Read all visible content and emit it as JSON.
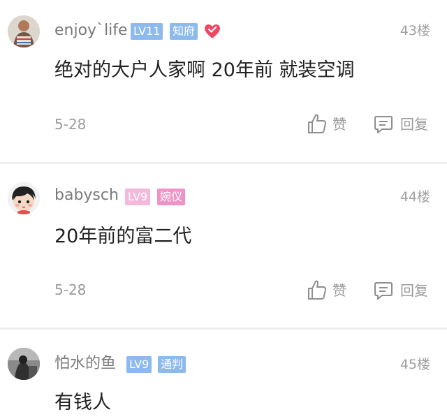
{
  "accent": "#8cb9ee",
  "posts": [
    {
      "username": "enjoy`life",
      "level": "LV11",
      "title": "知府",
      "floor": "43楼",
      "text": "绝对的大户人家啊 20年前 就装空调",
      "date": "5-28",
      "like_label": "赞",
      "reply_label": "回复",
      "level_color": "#8cb9ee",
      "title_color": "#8cb9ee",
      "has_heart": true
    },
    {
      "username": "babysch",
      "level": "LV9",
      "title": "婉仪",
      "floor": "44楼",
      "text": "20年前的富二代",
      "date": "5-28",
      "like_label": "赞",
      "reply_label": "回复",
      "level_color": "#f4b8dc",
      "title_color": "#ef92c6",
      "has_heart": false
    },
    {
      "username": "怕水的鱼",
      "level": "LV9",
      "title": "通判",
      "floor": "45楼",
      "text": "有钱人",
      "level_color": "#8cb9ee",
      "title_color": "#8cb9ee",
      "has_heart": false
    }
  ]
}
